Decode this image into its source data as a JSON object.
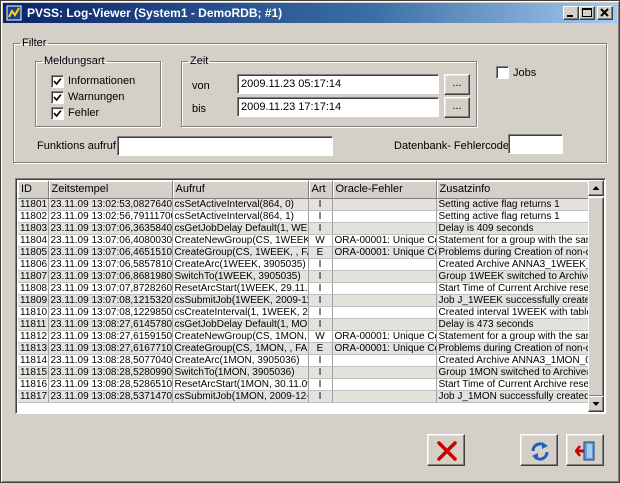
{
  "window": {
    "title": "PVSS: Log-Viewer (System1 - DemoRDB; #1)"
  },
  "filter": {
    "legend": "Filter",
    "meldungsart": {
      "legend": "Meldungsart",
      "items": [
        {
          "label": "Informationen",
          "checked": true
        },
        {
          "label": "Warnungen",
          "checked": true
        },
        {
          "label": "Fehler",
          "checked": true
        }
      ]
    },
    "zeit": {
      "legend": "Zeit",
      "von_label": "von",
      "von_value": "2009.11.23 05:17:14",
      "bis_label": "bis",
      "bis_value": "2009.11.23 17:17:14",
      "picker_label": "..."
    },
    "jobs": {
      "label": "Jobs",
      "checked": false
    },
    "funktionsaufruf": {
      "label": "Funktions aufruf",
      "value": ""
    },
    "fehlercode": {
      "label": "Datenbank- Fehlercode",
      "value": ""
    }
  },
  "table": {
    "columns": [
      "ID",
      "Zeitstempel",
      "Aufruf",
      "Art",
      "Oracle-Fehler",
      "Zusatzinfo"
    ],
    "rows": [
      [
        "11801",
        "23.11.09 13:02:53,082764000",
        "csSetActiveInterval(864, 0)",
        "I",
        "",
        "Setting active flag returns 1"
      ],
      [
        "11802",
        "23.11.09 13:02:56,791117000",
        "csSetActiveInterval(864, 1)",
        "I",
        "",
        "Setting active flag returns 1"
      ],
      [
        "11803",
        "23.11.09 13:07:06,363584000",
        "csGetJobDelay Default(1, WEE",
        "I",
        "",
        "Delay is 409 seconds"
      ],
      [
        "11804",
        "23.11.09 13:07:06,408003000",
        "CreateNewGroup(CS, 1WEEK, 1",
        "W",
        "ORA-00001: Unique Cor",
        "Statement for a group with the same"
      ],
      [
        "11805",
        "23.11.09 13:07:06,465151000",
        "CreateGroup(CS, 1WEEK, , FAL",
        "E",
        "ORA-00001: Unique Cor",
        "Problems during Creation of non-dyn"
      ],
      [
        "11806",
        "23.11.09 13:07:06,585781000",
        "CreateArc(1WEEK, 3905035)",
        "I",
        "",
        "Created Archive ANNA3_1WEEK_039"
      ],
      [
        "11807",
        "23.11.09 13:07:06,868198000",
        "SwitchTo(1WEEK, 3905035)",
        "I",
        "",
        "Group 1WEEK switched to Archive# 3"
      ],
      [
        "11808",
        "23.11.09 13:07:07,872826000",
        "ResetArcStart(1WEEK, 29.11.09",
        "I",
        "",
        "Start Time of Current Archive reset"
      ],
      [
        "11809",
        "23.11.09 13:07:08,121532000",
        "csSubmitJob(1WEEK, 2009-11-3",
        "I",
        "",
        "Job J_1WEEK successfully created"
      ],
      [
        "11810",
        "23.11.09 13:07:08,122985000",
        "csCreateInterval(1, 1WEEK, 200",
        "I",
        "",
        "Created interval 1WEEK with tables,"
      ],
      [
        "11811",
        "23.11.09 13:08:27,614578000",
        "csGetJobDelay Default(1, MONT",
        "I",
        "",
        "Delay is 473 seconds"
      ],
      [
        "11812",
        "23.11.09 13:08:27,615915000",
        "CreateNewGroup(CS, 1MON, 1",
        "W",
        "ORA-00001: Unique Cor",
        "Statement for a group with the same"
      ],
      [
        "11813",
        "23.11.09 13:08:27,616771000",
        "CreateGroup(CS, 1MON, , FALS",
        "E",
        "ORA-00001: Unique Cor",
        "Problems during Creation of non-dyn"
      ],
      [
        "11814",
        "23.11.09 13:08:28,507704000",
        "CreateArc(1MON, 3905036)",
        "I",
        "",
        "Created Archive ANNA3_1MON_0390"
      ],
      [
        "11815",
        "23.11.09 13:08:28,528099000",
        "SwitchTo(1MON, 3905036)",
        "I",
        "",
        "Group 1MON switched to Archive# 39"
      ],
      [
        "11816",
        "23.11.09 13:08:28,528651000",
        "ResetArcStart(1MON, 30.11.09",
        "I",
        "",
        "Start Time of Current Archive reset"
      ],
      [
        "11817",
        "23.11.09 13:08:28,537147000",
        "csSubmitJob(1MON, 2009-12-01",
        "I",
        "",
        "Job J_1MON successfully created"
      ]
    ]
  },
  "icons": {
    "app": "pvss-app-icon",
    "cancel": "red-x-icon",
    "refresh": "refresh-arrows-icon",
    "exit": "exit-door-icon"
  },
  "colors": {
    "title_start": "#0a246a",
    "title_end": "#a6caf0",
    "cancel_red": "#cc0000",
    "refresh_blue": "#2060c0"
  }
}
